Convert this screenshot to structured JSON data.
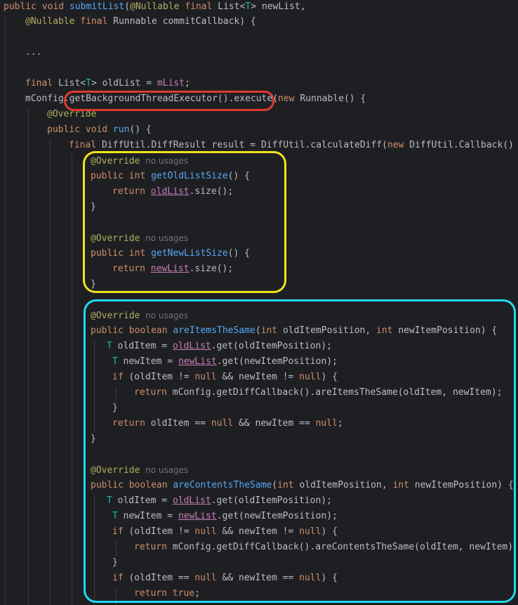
{
  "colors": {
    "background": "#1e1f22",
    "keyword": "#cf8e6d",
    "annotation": "#b3ae60",
    "method": "#56a8f5",
    "type_param": "#16baac",
    "field": "#c77dbb",
    "hint": "#6f737a",
    "plain": "#bcbec4",
    "highlight_red": "#e03a2f",
    "highlight_yellow": "#f2e21b",
    "highlight_cyan": "#22d8ee"
  },
  "code_lines": [
    {
      "tokens": [
        {
          "t": "public void ",
          "c": "kw"
        },
        {
          "t": "submitList",
          "c": "fn"
        },
        {
          "t": "(",
          "c": "pl"
        },
        {
          "t": "@Nullable ",
          "c": "ann"
        },
        {
          "t": "final ",
          "c": "kw"
        },
        {
          "t": "List<",
          "c": "pl"
        },
        {
          "t": "T",
          "c": "tp"
        },
        {
          "t": "> newList,",
          "c": "pl"
        }
      ]
    },
    {
      "tokens": [
        {
          "t": "@Nullable ",
          "c": "ann"
        },
        {
          "t": "final ",
          "c": "kw"
        },
        {
          "t": "Runnable commitCallback) {",
          "c": "pl"
        }
      ]
    },
    {
      "tokens": []
    },
    {
      "tokens": [
        {
          "t": "...",
          "c": "pl"
        }
      ]
    },
    {
      "tokens": []
    },
    {
      "tokens": [
        {
          "t": "final ",
          "c": "kw"
        },
        {
          "t": "List<",
          "c": "pl"
        },
        {
          "t": "T",
          "c": "tp"
        },
        {
          "t": "> oldList = ",
          "c": "pl"
        },
        {
          "t": "mList",
          "c": "fld"
        },
        {
          "t": ";",
          "c": "pl"
        }
      ]
    },
    {
      "tokens": [
        {
          "t": "mConfig.getBackgroundThreadExecutor().execute(",
          "c": "pl"
        },
        {
          "t": "new ",
          "c": "kw"
        },
        {
          "t": "Runnable() {",
          "c": "pl"
        }
      ]
    },
    {
      "tokens": [
        {
          "t": "@Override",
          "c": "ann"
        }
      ]
    },
    {
      "tokens": [
        {
          "t": "public void ",
          "c": "kw"
        },
        {
          "t": "run",
          "c": "fn"
        },
        {
          "t": "() {",
          "c": "pl"
        }
      ]
    },
    {
      "tokens": [
        {
          "t": "final ",
          "c": "kw"
        },
        {
          "t": "DiffUtil.DiffResult result = DiffUtil.calculateDiff(",
          "c": "pl"
        },
        {
          "t": "new ",
          "c": "kw"
        },
        {
          "t": "DiffUtil.Callback()",
          "c": "pl"
        }
      ]
    },
    {
      "tokens": [
        {
          "t": "@Override",
          "c": "ann"
        },
        {
          "t": "  no usages",
          "c": "hint"
        }
      ]
    },
    {
      "tokens": [
        {
          "t": "public int ",
          "c": "kw"
        },
        {
          "t": "getOldListSize",
          "c": "fn"
        },
        {
          "t": "() {",
          "c": "pl"
        }
      ]
    },
    {
      "tokens": [
        {
          "t": "return ",
          "c": "kw"
        },
        {
          "t": "oldList",
          "c": "cap"
        },
        {
          "t": ".size();",
          "c": "pl"
        }
      ]
    },
    {
      "tokens": [
        {
          "t": "}",
          "c": "pl"
        }
      ]
    },
    {
      "tokens": []
    },
    {
      "tokens": [
        {
          "t": "@Override",
          "c": "ann"
        },
        {
          "t": "  no usages",
          "c": "hint"
        }
      ]
    },
    {
      "tokens": [
        {
          "t": "public int ",
          "c": "kw"
        },
        {
          "t": "getNewListSize",
          "c": "fn"
        },
        {
          "t": "() {",
          "c": "pl"
        }
      ]
    },
    {
      "tokens": [
        {
          "t": "return ",
          "c": "kw"
        },
        {
          "t": "newList",
          "c": "cap"
        },
        {
          "t": ".size();",
          "c": "pl"
        }
      ]
    },
    {
      "tokens": [
        {
          "t": "}",
          "c": "pl"
        }
      ]
    },
    {
      "tokens": []
    },
    {
      "tokens": [
        {
          "t": "@Override",
          "c": "ann"
        },
        {
          "t": "  no usages",
          "c": "hint"
        }
      ]
    },
    {
      "tokens": [
        {
          "t": "public boolean ",
          "c": "kw"
        },
        {
          "t": "areItemsTheSame",
          "c": "fn"
        },
        {
          "t": "(",
          "c": "pl"
        },
        {
          "t": "int ",
          "c": "kw"
        },
        {
          "t": "oldItemPosition, ",
          "c": "pl"
        },
        {
          "t": "int ",
          "c": "kw"
        },
        {
          "t": "newItemPosition) {",
          "c": "pl"
        }
      ]
    },
    {
      "tokens": [
        {
          "t": "T ",
          "c": "tp"
        },
        {
          "t": "oldItem = ",
          "c": "pl"
        },
        {
          "t": "oldList",
          "c": "cap"
        },
        {
          "t": ".get(oldItemPosition);",
          "c": "pl"
        }
      ]
    },
    {
      "tokens": [
        {
          "t": "T ",
          "c": "tp"
        },
        {
          "t": "newItem = ",
          "c": "pl"
        },
        {
          "t": "newList",
          "c": "cap"
        },
        {
          "t": ".get(newItemPosition);",
          "c": "pl"
        }
      ]
    },
    {
      "tokens": [
        {
          "t": "if ",
          "c": "kw"
        },
        {
          "t": "(oldItem != ",
          "c": "pl"
        },
        {
          "t": "null ",
          "c": "kw"
        },
        {
          "t": "&& newItem != ",
          "c": "pl"
        },
        {
          "t": "null",
          "c": "kw"
        },
        {
          "t": ") {",
          "c": "pl"
        }
      ]
    },
    {
      "tokens": [
        {
          "t": "return ",
          "c": "kw"
        },
        {
          "t": "mConfig.getDiffCallback().areItemsTheSame(oldItem, newItem);",
          "c": "pl"
        }
      ]
    },
    {
      "tokens": [
        {
          "t": "}",
          "c": "pl"
        }
      ]
    },
    {
      "tokens": [
        {
          "t": "return ",
          "c": "kw"
        },
        {
          "t": "oldItem == ",
          "c": "pl"
        },
        {
          "t": "null ",
          "c": "kw"
        },
        {
          "t": "&& newItem == ",
          "c": "pl"
        },
        {
          "t": "null",
          "c": "kw"
        },
        {
          "t": ";",
          "c": "pl"
        }
      ]
    },
    {
      "tokens": [
        {
          "t": "}",
          "c": "pl"
        }
      ]
    },
    {
      "tokens": []
    },
    {
      "tokens": [
        {
          "t": "@Override",
          "c": "ann"
        },
        {
          "t": "  no usages",
          "c": "hint"
        }
      ]
    },
    {
      "tokens": [
        {
          "t": "public boolean ",
          "c": "kw"
        },
        {
          "t": "areContentsTheSame",
          "c": "fn"
        },
        {
          "t": "(",
          "c": "pl"
        },
        {
          "t": "int ",
          "c": "kw"
        },
        {
          "t": "oldItemPosition, ",
          "c": "pl"
        },
        {
          "t": "int ",
          "c": "kw"
        },
        {
          "t": "newItemPosition) {",
          "c": "pl"
        }
      ]
    },
    {
      "tokens": [
        {
          "t": "T ",
          "c": "tp"
        },
        {
          "t": "oldItem = ",
          "c": "pl"
        },
        {
          "t": "oldList",
          "c": "cap"
        },
        {
          "t": ".get(oldItemPosition);",
          "c": "pl"
        }
      ]
    },
    {
      "tokens": [
        {
          "t": "T ",
          "c": "tp"
        },
        {
          "t": "newItem = ",
          "c": "pl"
        },
        {
          "t": "newList",
          "c": "cap"
        },
        {
          "t": ".get(newItemPosition);",
          "c": "pl"
        }
      ]
    },
    {
      "tokens": [
        {
          "t": "if ",
          "c": "kw"
        },
        {
          "t": "(oldItem != ",
          "c": "pl"
        },
        {
          "t": "null ",
          "c": "kw"
        },
        {
          "t": "&& newItem != ",
          "c": "pl"
        },
        {
          "t": "null",
          "c": "kw"
        },
        {
          "t": ") {",
          "c": "pl"
        }
      ]
    },
    {
      "tokens": [
        {
          "t": "return ",
          "c": "kw"
        },
        {
          "t": "mConfig.getDiffCallback().areContentsTheSame(oldItem, newItem)",
          "c": "pl"
        }
      ]
    },
    {
      "tokens": [
        {
          "t": "}",
          "c": "pl"
        }
      ]
    },
    {
      "tokens": [
        {
          "t": "if ",
          "c": "kw"
        },
        {
          "t": "(oldItem == ",
          "c": "pl"
        },
        {
          "t": "null ",
          "c": "kw"
        },
        {
          "t": "&& newItem == ",
          "c": "pl"
        },
        {
          "t": "null",
          "c": "kw"
        },
        {
          "t": ") {",
          "c": "pl"
        }
      ]
    },
    {
      "tokens": [
        {
          "t": "return true",
          "c": "kw"
        },
        {
          "t": ";",
          "c": "pl"
        }
      ]
    }
  ]
}
